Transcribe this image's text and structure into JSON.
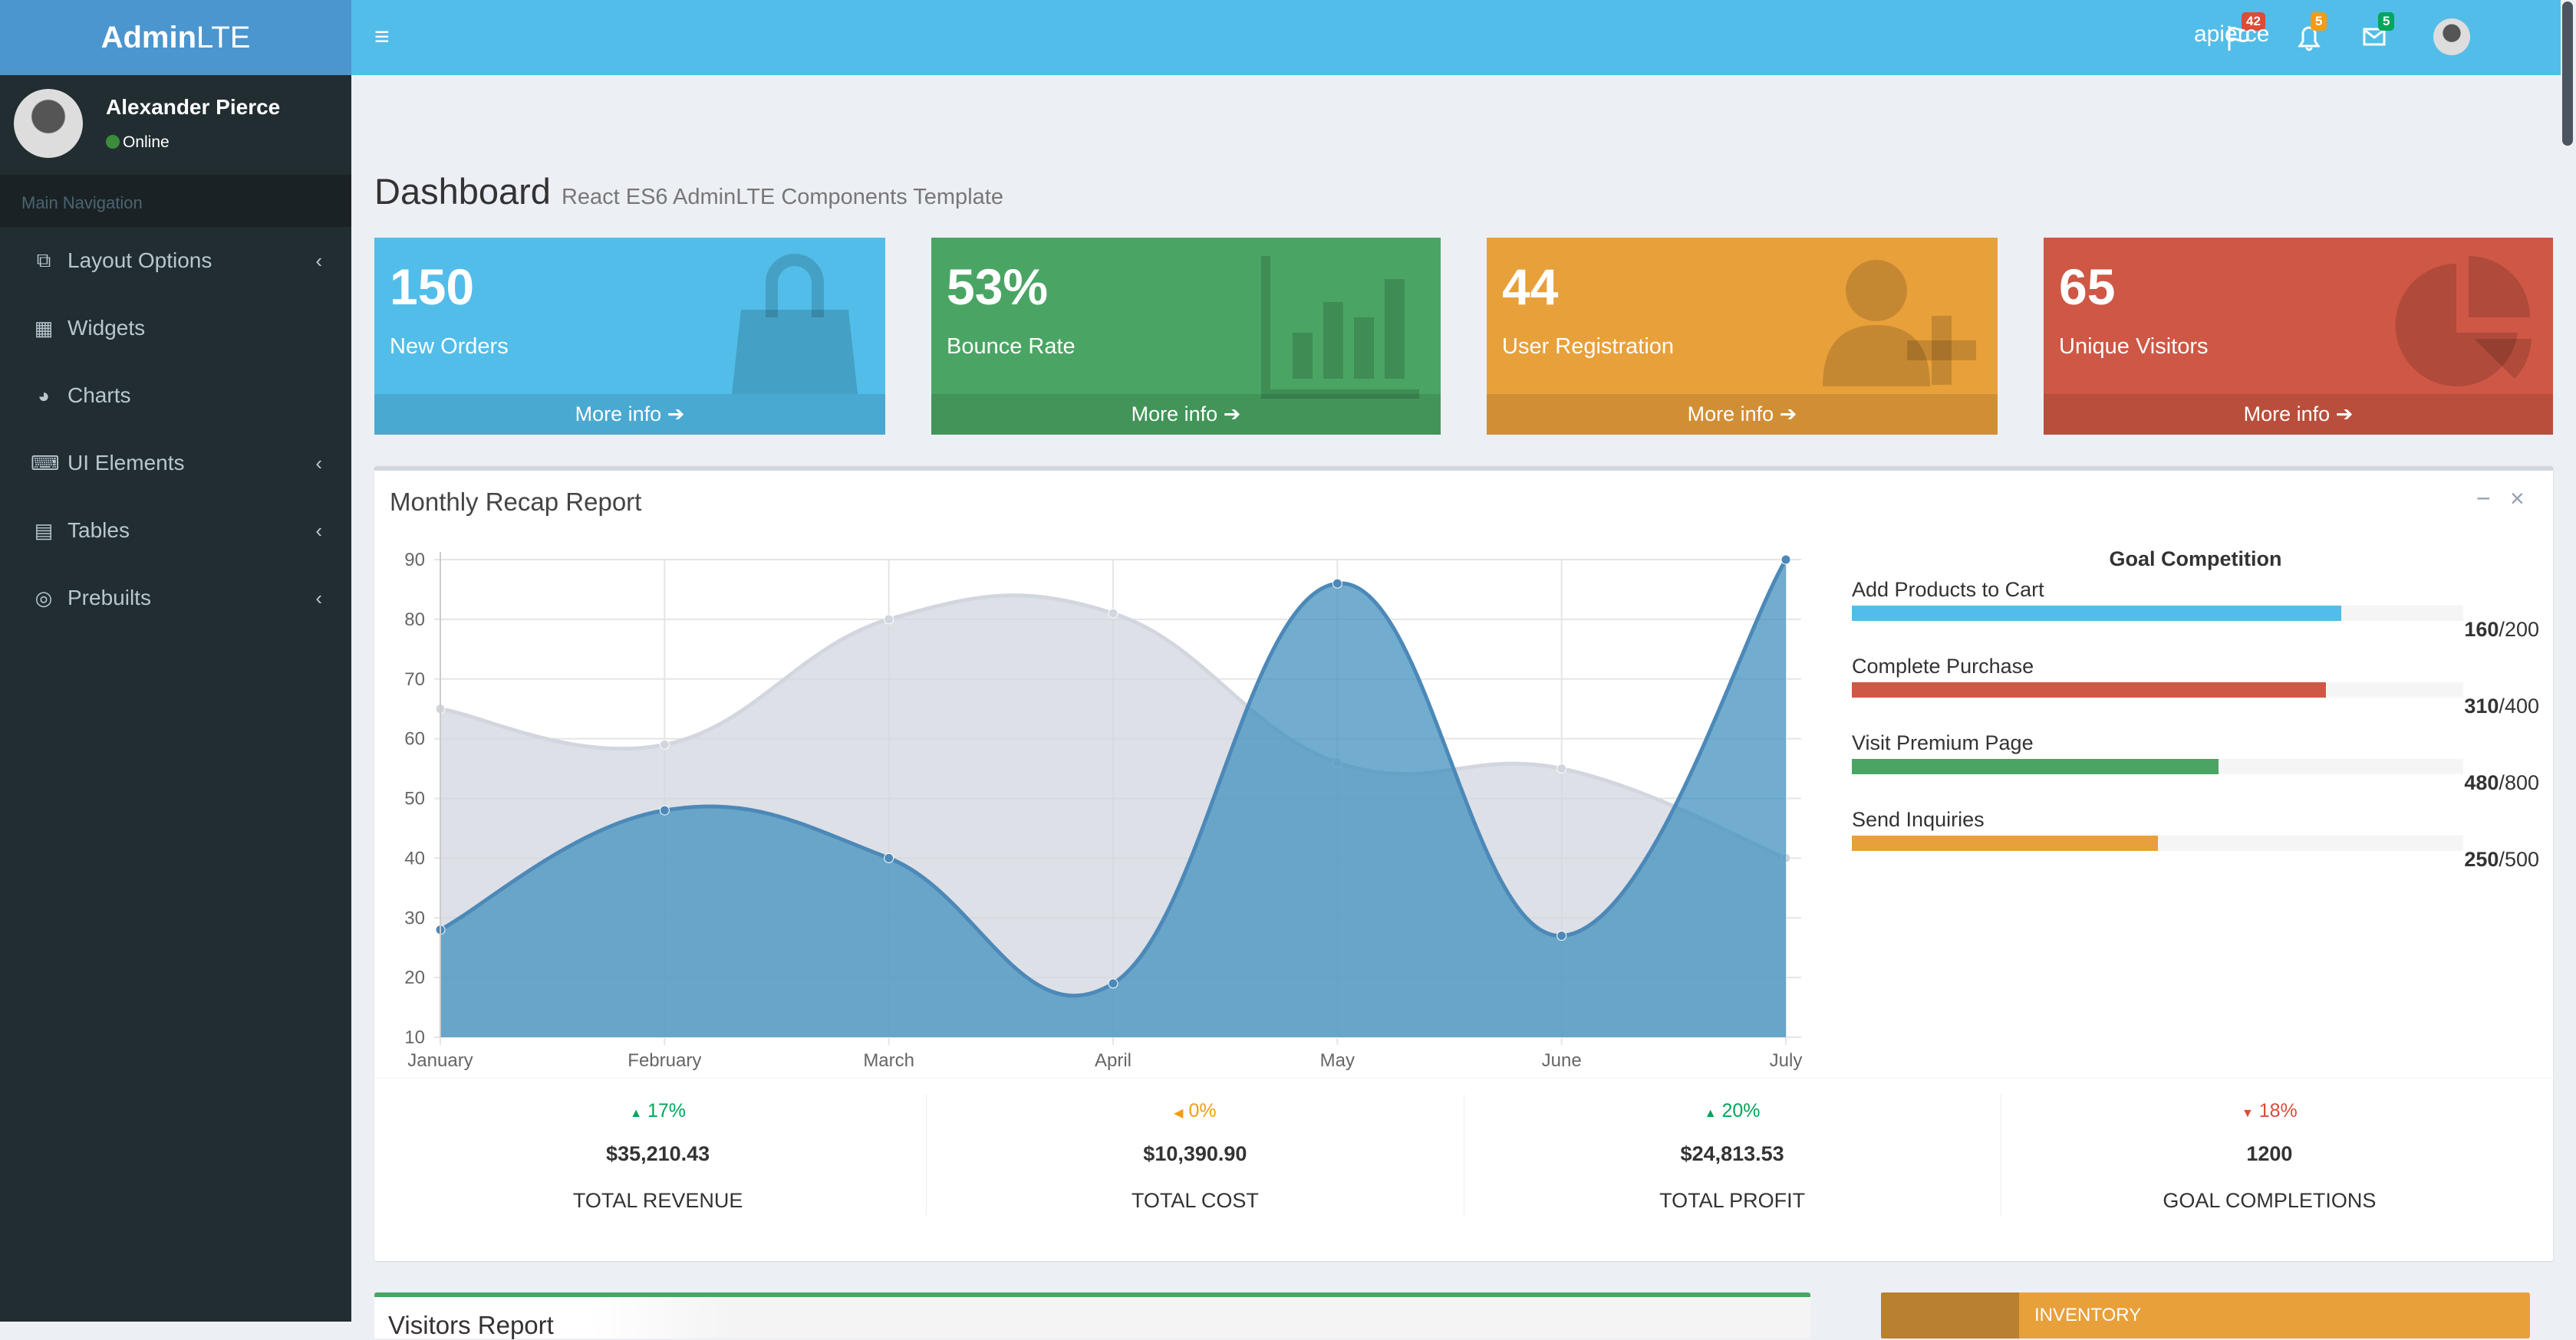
{
  "logo": {
    "bold": "Admin",
    "light": "LTE"
  },
  "topnav": {
    "flags_badge": "42",
    "bell_badge": "5",
    "mail_badge": "5",
    "username": "apierce",
    "colors": {
      "flags": "#dd4b39",
      "bell": "#f39c12",
      "mail": "#00a65a"
    }
  },
  "user": {
    "name": "Alexander Pierce",
    "status": "Online"
  },
  "sidebar": {
    "header": "Main Navigation",
    "items": [
      {
        "label": "Layout Options",
        "icon": "files-icon",
        "chevron": true
      },
      {
        "label": "Widgets",
        "icon": "th-icon",
        "chevron": false
      },
      {
        "label": "Charts",
        "icon": "pie-chart-icon",
        "chevron": false
      },
      {
        "label": "UI Elements",
        "icon": "laptop-icon",
        "chevron": true
      },
      {
        "label": "Tables",
        "icon": "table-icon",
        "chevron": true
      },
      {
        "label": "Prebuilts",
        "icon": "bullseye-icon",
        "chevron": true
      }
    ]
  },
  "page": {
    "title": "Dashboard",
    "subtitle": "React ES6 AdminLTE Components Template"
  },
  "info_boxes": [
    {
      "value": "150",
      "label": "New Orders",
      "footer": "More info",
      "color": "#52bde9",
      "icon": "shopping-bag-icon"
    },
    {
      "value": "53%",
      "label": "Bounce Rate",
      "footer": "More info",
      "color": "#4aa564",
      "icon": "bar-chart-icon"
    },
    {
      "value": "44",
      "label": "User Registration",
      "footer": "More info",
      "color": "#e8a03b",
      "icon": "user-plus-icon"
    },
    {
      "value": "65",
      "label": "Unique Visitors",
      "footer": "More info",
      "color": "#cf5745",
      "icon": "pie-chart-icon"
    }
  ],
  "recap": {
    "title": "Monthly Recap Report",
    "goal_title": "Goal Competition",
    "goals": [
      {
        "label": "Add Products to Cart",
        "current": "160",
        "total": "200",
        "fraction": 0.8,
        "color": "#52bde9"
      },
      {
        "label": "Complete Purchase",
        "current": "310",
        "total": "400",
        "fraction": 0.775,
        "color": "#cf5745"
      },
      {
        "label": "Visit Premium Page",
        "current": "480",
        "total": "800",
        "fraction": 0.6,
        "color": "#4aa564"
      },
      {
        "label": "Send Inquiries",
        "current": "250",
        "total": "500",
        "fraction": 0.5,
        "color": "#e8a03b"
      }
    ],
    "stats": [
      {
        "pct": "17%",
        "dir": "up",
        "color": "#00a65a",
        "amount": "$35,210.43",
        "name": "TOTAL REVENUE"
      },
      {
        "pct": "0%",
        "dir": "left",
        "color": "#f39c12",
        "amount": "$10,390.90",
        "name": "TOTAL COST"
      },
      {
        "pct": "20%",
        "dir": "up",
        "color": "#00a65a",
        "amount": "$24,813.53",
        "name": "TOTAL PROFIT"
      },
      {
        "pct": "18%",
        "dir": "down",
        "color": "#dd4b39",
        "amount": "1200",
        "name": "GOAL COMPLETIONS"
      }
    ]
  },
  "chart_data": {
    "type": "area",
    "categories": [
      "January",
      "February",
      "March",
      "April",
      "May",
      "June",
      "July"
    ],
    "ylim": [
      10,
      90
    ],
    "yticks": [
      10,
      20,
      30,
      40,
      50,
      60,
      70,
      80,
      90
    ],
    "grid": true,
    "series": [
      {
        "values": [
          65,
          59,
          80,
          81,
          56,
          55,
          40
        ],
        "color": "#d2d6de"
      },
      {
        "values": [
          28,
          48,
          40,
          19,
          86,
          27,
          90
        ],
        "color": "#3c8dbc"
      }
    ]
  },
  "bottom": {
    "visitors_title": "Visitors Report",
    "inventory_label": "INVENTORY"
  }
}
